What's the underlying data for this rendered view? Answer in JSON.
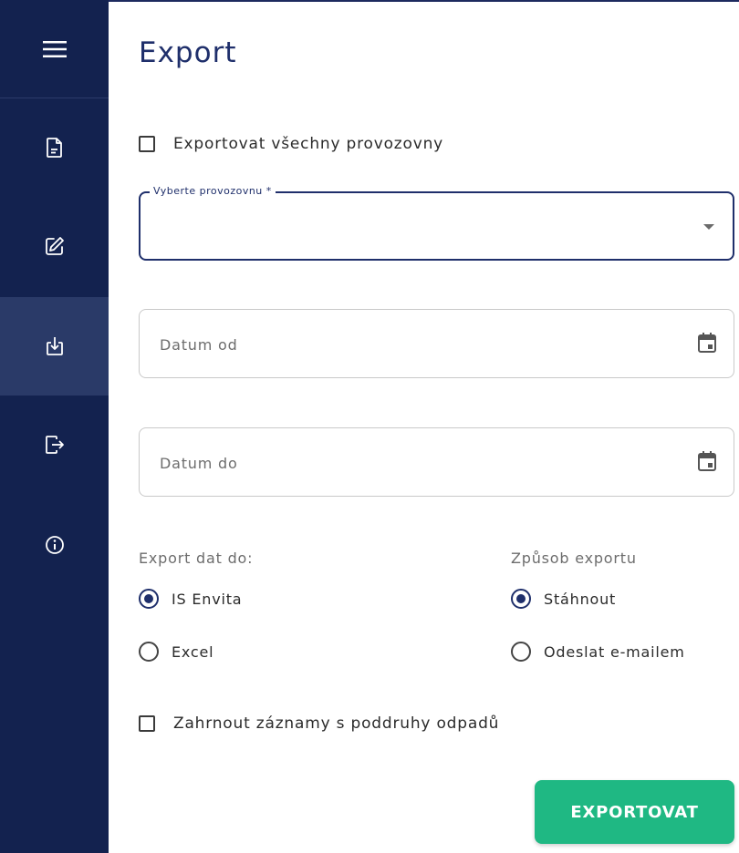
{
  "page": {
    "title": "Export"
  },
  "export_all": {
    "label": "Exportovat všechny provozovny",
    "checked": false
  },
  "workplace_select": {
    "label": "Vyberte provozovnu *",
    "value": ""
  },
  "date_from": {
    "placeholder": "Datum od",
    "value": ""
  },
  "date_to": {
    "placeholder": "Datum do",
    "value": ""
  },
  "export_target": {
    "label": "Export dat do:",
    "options": [
      {
        "label": "IS Envita",
        "selected": true
      },
      {
        "label": "Excel",
        "selected": false
      }
    ]
  },
  "export_method": {
    "label": "Způsob exportu",
    "options": [
      {
        "label": "Stáhnout",
        "selected": true
      },
      {
        "label": "Odeslat e-mailem",
        "selected": false
      }
    ]
  },
  "include_subtypes": {
    "label": "Zahrnout záznamy s poddruhy odpadů",
    "checked": false
  },
  "submit": {
    "label": "EXPORTOVAT"
  },
  "sidebar": {
    "items": [
      {
        "icon": "document-icon",
        "active": false
      },
      {
        "icon": "edit-icon",
        "active": false
      },
      {
        "icon": "download-icon",
        "active": true
      },
      {
        "icon": "logout-icon",
        "active": false
      },
      {
        "icon": "info-icon",
        "active": false
      }
    ]
  },
  "colors": {
    "sidebar": "#13224f",
    "sidebar_active": "#2a3a68",
    "primary": "#1f2f6b",
    "accent": "#1fb883"
  }
}
